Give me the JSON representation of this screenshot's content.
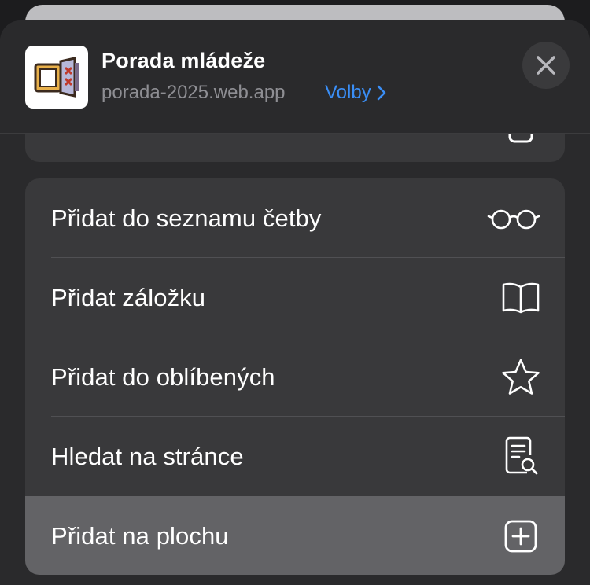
{
  "app": {
    "title": "Porada mládeže",
    "url": "porada-2025.web.app",
    "options_label": "Volby",
    "icon": "app-logo-icon"
  },
  "header": {
    "close_icon": "close-icon",
    "chevron_icon": "chevron-right-icon"
  },
  "menu": {
    "items": [
      {
        "label": "Přidat do seznamu četby",
        "icon": "glasses-icon"
      },
      {
        "label": "Přidat záložku",
        "icon": "book-icon"
      },
      {
        "label": "Přidat do oblíbených",
        "icon": "star-icon"
      },
      {
        "label": "Hledat na stránce",
        "icon": "find-in-page-icon"
      },
      {
        "label": "Přidat na plochu",
        "icon": "plus-square-icon",
        "highlighted": true
      }
    ]
  },
  "colors": {
    "background": "#1c1c1e",
    "sheet": "#2a2a2c",
    "group": "#39393b",
    "highlight": "#636366",
    "accent": "#3a8ef6",
    "secondary_text": "#8e8e93"
  }
}
